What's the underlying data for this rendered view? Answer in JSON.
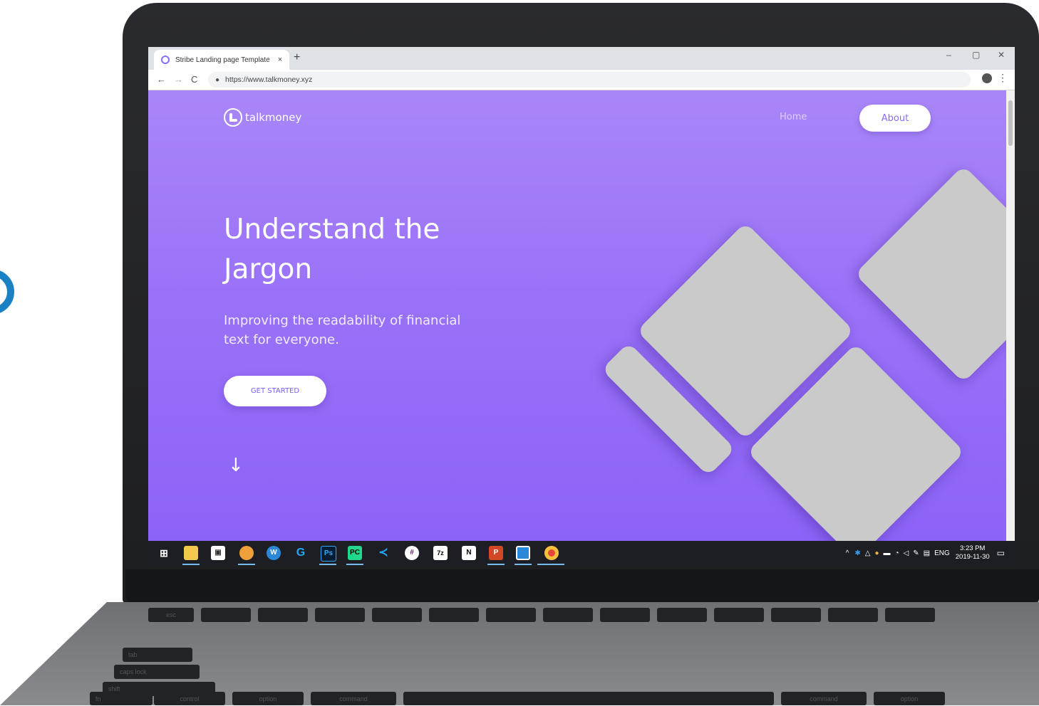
{
  "browser": {
    "tab_title": "Stribe Landing page Template",
    "tab_close": "×",
    "new_tab": "+",
    "window_controls": {
      "minimize": "–",
      "restore": "▢",
      "close": "✕"
    },
    "nav": {
      "back": "←",
      "forward": "→",
      "reload": "C"
    },
    "url": "https://www.talkmoney.xyz",
    "menu": "⋮"
  },
  "site": {
    "brand": "talkmoney",
    "nav": {
      "home": "Home",
      "about": "About"
    },
    "hero": {
      "title": "Understand the Jargon",
      "subtitle": "Improving the readability of financial text for everyone.",
      "cta": "GET STARTED",
      "scroll_arrow": "↓"
    },
    "colors": {
      "gradient_top": "#a986f8",
      "gradient_bottom": "#8c63f7",
      "tile": "#cacaca",
      "accent": "#8b6cf4"
    }
  },
  "taskbar": {
    "apps": [
      "windows-start",
      "file-explorer",
      "store",
      "chrome-canary",
      "word-app",
      "logitech",
      "photoshop",
      "pycharm",
      "vscode",
      "slack",
      "7zip",
      "notion",
      "powerpoint",
      "app-framed",
      "chrome"
    ],
    "ps_label": "Ps",
    "pc_label": "PC",
    "z7_label": "7z",
    "n_label": "N",
    "p_label": "P",
    "lang": "ENG",
    "time": "3:23 PM",
    "date": "2019-11-30"
  },
  "keyboard": {
    "row1": [
      "esc",
      "",
      "",
      "",
      "",
      "",
      "",
      "",
      "",
      "",
      "",
      "",
      "",
      ""
    ],
    "labels": {
      "tab": "tab",
      "caps": "caps lock",
      "shift": "shift",
      "fn": "fn",
      "control": "control",
      "option": "option",
      "command": "command",
      "command_r": "command",
      "option_r": "option"
    }
  }
}
